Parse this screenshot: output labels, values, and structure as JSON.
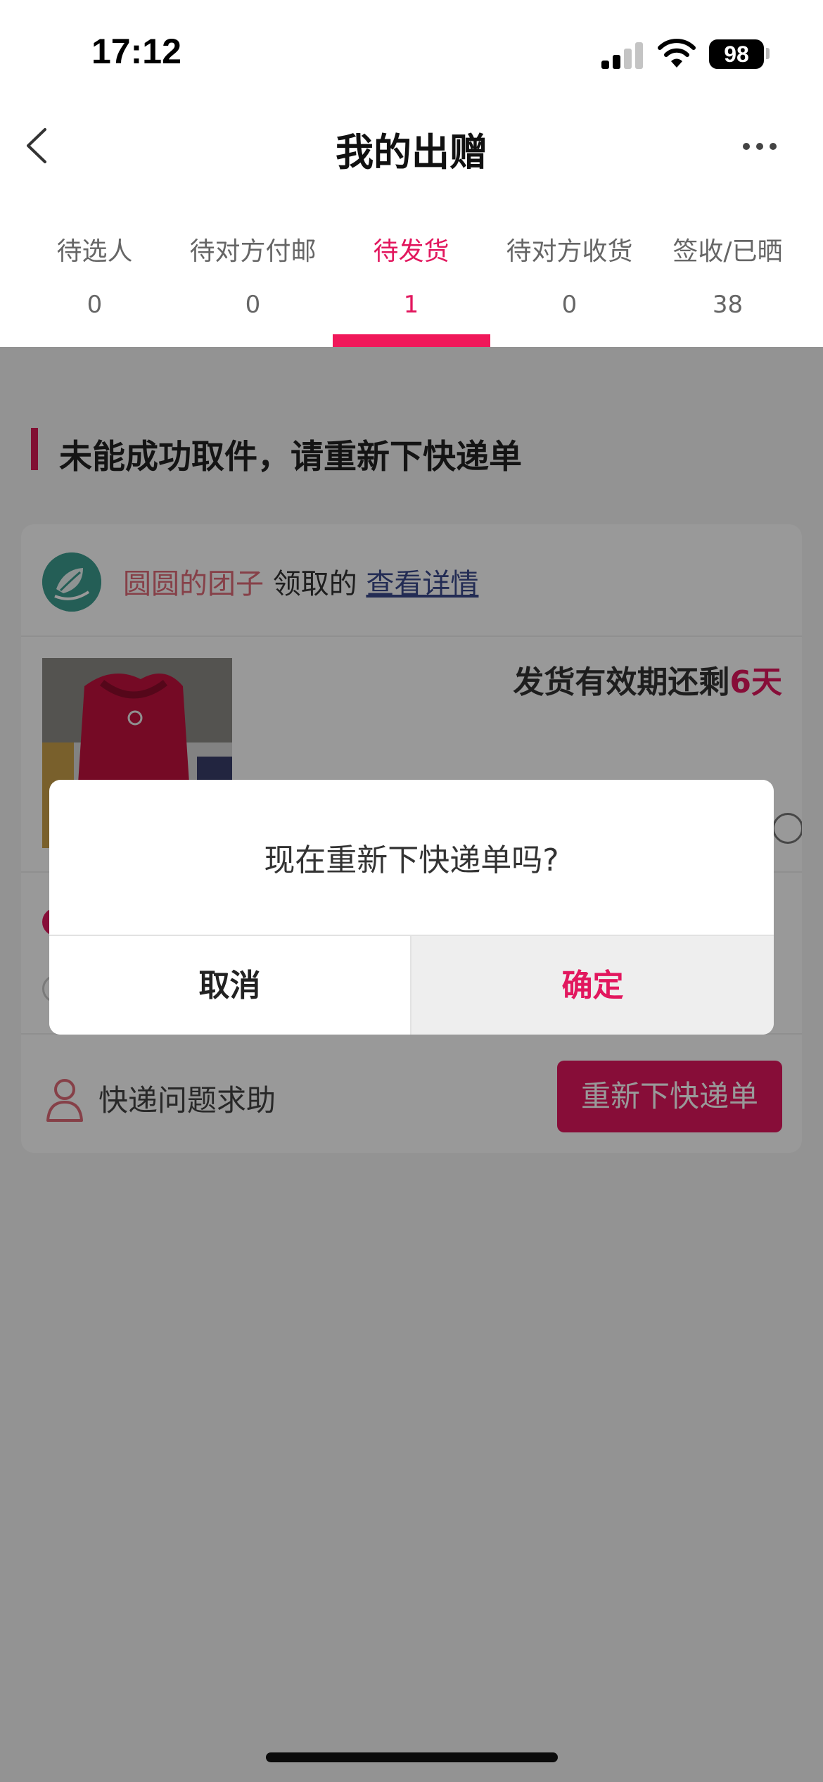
{
  "status_bar": {
    "time": "17:12",
    "battery": "98"
  },
  "nav": {
    "title": "我的出赠"
  },
  "tabs": [
    {
      "label": "待选人",
      "count": "0"
    },
    {
      "label": "待对方付邮",
      "count": "0"
    },
    {
      "label": "待发货",
      "count": "1"
    },
    {
      "label": "待对方收货",
      "count": "0"
    },
    {
      "label": "签收/已晒",
      "count": "38"
    }
  ],
  "active_tab": "待发货",
  "section": {
    "title": "未能成功取件，请重新下快递单"
  },
  "card": {
    "giver_name": "圆圆的团子",
    "giver_verb": "领取的",
    "detail_link": "查看详情",
    "deadline_prefix": "发货有效期还剩",
    "deadline_days": "6天",
    "help_label": "快递问题求助",
    "reorder_button": "重新下快递单"
  },
  "dialog": {
    "message": "现在重新下快递单吗?",
    "cancel": "取消",
    "confirm": "确定"
  },
  "colors": {
    "accent": "#e2175e",
    "overlay": "rgba(0,0,0,0.4)"
  }
}
